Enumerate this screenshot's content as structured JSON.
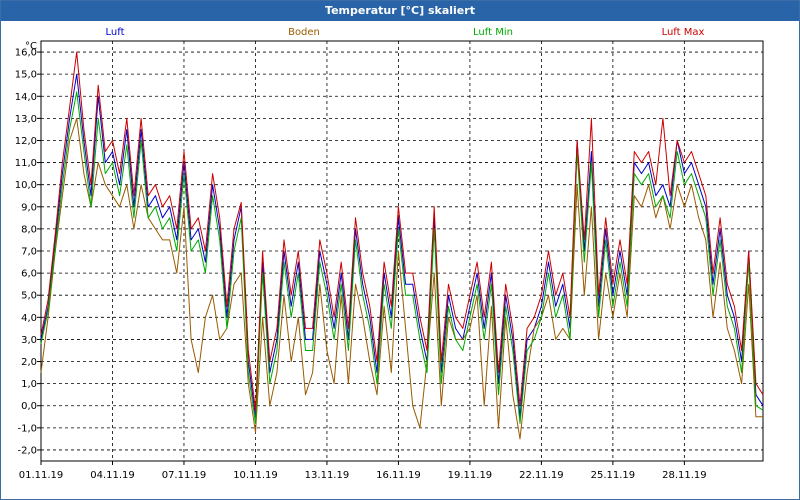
{
  "window": {
    "title": "Temperatur [°C] skaliert"
  },
  "chart_data": {
    "type": "line",
    "ylabel": "°C",
    "ylim": [
      -2.5,
      16.5
    ],
    "grid": true,
    "legend_placement": "top",
    "yticks": [
      -2,
      -1,
      0,
      1,
      2,
      3,
      4,
      5,
      6,
      7,
      8,
      9,
      10,
      11,
      12,
      13,
      14,
      15,
      16
    ],
    "ytick_labels": [
      "-2,0",
      "-1,0",
      "0,0",
      "1,0",
      "2,0",
      "3,0",
      "4,0",
      "5,0",
      "6,0",
      "7,0",
      "8,0",
      "9,0",
      "10,0",
      "11,0",
      "12,0",
      "13,0",
      "14,0",
      "15,0",
      "16,0"
    ],
    "xticks": [
      1,
      4,
      7,
      10,
      13,
      16,
      19,
      22,
      25,
      28
    ],
    "xtick_labels": [
      "01.11.19",
      "04.11.19",
      "07.11.19",
      "10.11.19",
      "13.11.19",
      "16.11.19",
      "19.11.19",
      "22.11.19",
      "25.11.19",
      "28.11.19"
    ],
    "xlim": [
      1,
      31.3
    ],
    "x": [
      1.0,
      1.3,
      1.6,
      1.9,
      2.2,
      2.5,
      2.8,
      3.1,
      3.4,
      3.7,
      4.0,
      4.3,
      4.6,
      4.9,
      5.2,
      5.5,
      5.8,
      6.1,
      6.4,
      6.7,
      7.0,
      7.3,
      7.6,
      7.9,
      8.2,
      8.5,
      8.8,
      9.1,
      9.4,
      9.7,
      10.0,
      10.3,
      10.6,
      10.9,
      11.2,
      11.5,
      11.8,
      12.1,
      12.4,
      12.7,
      13.0,
      13.3,
      13.6,
      13.9,
      14.2,
      14.5,
      14.8,
      15.1,
      15.4,
      15.7,
      16.0,
      16.3,
      16.6,
      16.9,
      17.2,
      17.5,
      17.8,
      18.1,
      18.4,
      18.7,
      19.0,
      19.3,
      19.6,
      19.9,
      20.2,
      20.5,
      20.8,
      21.1,
      21.4,
      21.7,
      22.0,
      22.3,
      22.6,
      22.9,
      23.2,
      23.5,
      23.8,
      24.1,
      24.4,
      24.7,
      25.0,
      25.3,
      25.6,
      25.9,
      26.2,
      26.5,
      26.8,
      27.1,
      27.4,
      27.7,
      28.0,
      28.3,
      28.6,
      28.9,
      29.2,
      29.5,
      29.8,
      30.1,
      30.4,
      30.7,
      31.0,
      31.3
    ],
    "series": [
      {
        "name": "Luft",
        "color": "#0000cc",
        "values": [
          3.0,
          4.5,
          7.5,
          10.5,
          13.0,
          15.0,
          12.0,
          9.5,
          14.0,
          11.0,
          11.5,
          10.0,
          12.5,
          9.0,
          12.5,
          9.0,
          9.5,
          8.5,
          9.0,
          7.5,
          11.0,
          7.5,
          8.0,
          6.5,
          10.0,
          8.0,
          4.0,
          7.5,
          9.0,
          2.0,
          -0.5,
          6.5,
          1.5,
          3.0,
          7.0,
          4.5,
          6.5,
          3.0,
          3.0,
          7.0,
          5.5,
          3.5,
          6.0,
          3.0,
          8.0,
          5.5,
          4.0,
          1.5,
          6.0,
          4.0,
          8.5,
          5.5,
          5.5,
          3.5,
          2.0,
          8.5,
          1.5,
          5.0,
          3.5,
          3.0,
          4.5,
          6.0,
          3.5,
          6.0,
          1.0,
          5.0,
          3.0,
          -0.5,
          3.0,
          3.5,
          4.5,
          6.5,
          4.5,
          5.5,
          3.5,
          12.0,
          7.0,
          11.5,
          4.5,
          8.0,
          5.0,
          7.0,
          5.0,
          11.0,
          10.5,
          11.0,
          9.5,
          10.0,
          9.0,
          12.0,
          10.5,
          11.0,
          10.0,
          9.0,
          5.5,
          8.0,
          5.0,
          4.0,
          2.0,
          7.0,
          0.5,
          0.0
        ]
      },
      {
        "name": "Boden",
        "color": "#9a5a00",
        "values": [
          1.5,
          4.0,
          7.0,
          9.5,
          12.0,
          13.0,
          10.5,
          9.0,
          11.0,
          10.0,
          9.5,
          9.0,
          10.0,
          8.0,
          10.0,
          8.5,
          8.0,
          7.5,
          7.5,
          6.0,
          9.0,
          3.0,
          1.5,
          4.0,
          5.0,
          3.0,
          3.5,
          5.5,
          6.0,
          1.0,
          -1.2,
          4.0,
          0.0,
          1.5,
          5.0,
          2.0,
          4.0,
          0.5,
          1.5,
          5.5,
          2.5,
          1.0,
          5.0,
          1.0,
          5.5,
          4.0,
          2.0,
          0.5,
          4.5,
          1.5,
          7.0,
          3.5,
          0.0,
          -1.0,
          2.0,
          6.0,
          0.0,
          4.0,
          3.0,
          3.0,
          3.5,
          5.0,
          0.0,
          4.5,
          -1.0,
          4.0,
          0.5,
          -1.5,
          1.5,
          3.5,
          4.0,
          5.0,
          3.0,
          3.5,
          3.0,
          10.0,
          5.0,
          9.0,
          3.0,
          6.0,
          4.0,
          6.0,
          4.0,
          9.5,
          9.0,
          10.0,
          8.5,
          9.5,
          8.0,
          10.0,
          9.0,
          10.0,
          8.5,
          7.5,
          4.0,
          6.5,
          3.5,
          2.5,
          1.0,
          5.5,
          -0.5,
          -0.5
        ]
      },
      {
        "name": "Luft Min",
        "color": "#00aa00",
        "values": [
          2.8,
          4.3,
          7.2,
          10.0,
          12.5,
          14.2,
          11.5,
          9.0,
          13.0,
          10.5,
          11.0,
          9.5,
          11.8,
          8.5,
          12.0,
          8.5,
          9.0,
          8.0,
          8.5,
          7.0,
          10.5,
          7.0,
          7.5,
          6.0,
          9.5,
          7.5,
          3.5,
          7.0,
          8.5,
          1.5,
          -0.8,
          6.0,
          1.0,
          2.5,
          6.5,
          4.0,
          6.0,
          2.5,
          2.5,
          6.5,
          5.0,
          3.0,
          5.5,
          2.5,
          7.5,
          5.0,
          3.5,
          1.0,
          5.5,
          3.5,
          8.0,
          5.0,
          5.0,
          3.0,
          1.5,
          8.0,
          1.0,
          4.5,
          3.0,
          2.5,
          4.0,
          5.5,
          3.0,
          5.5,
          0.5,
          4.5,
          2.5,
          -0.8,
          2.5,
          3.0,
          4.0,
          6.0,
          4.0,
          5.0,
          3.0,
          11.5,
          6.5,
          11.0,
          4.0,
          7.5,
          4.5,
          6.5,
          4.5,
          10.5,
          10.0,
          10.5,
          9.0,
          9.5,
          8.5,
          11.5,
          10.0,
          10.5,
          9.5,
          8.5,
          5.0,
          7.5,
          4.5,
          3.5,
          1.5,
          6.5,
          0.0,
          -0.2
        ]
      },
      {
        "name": "Luft Max",
        "color": "#cc0000",
        "values": [
          3.2,
          4.8,
          7.8,
          11.0,
          13.5,
          16.0,
          12.5,
          10.0,
          14.5,
          11.5,
          12.0,
          10.5,
          13.0,
          9.5,
          13.0,
          9.5,
          10.0,
          9.0,
          9.5,
          8.0,
          11.5,
          8.0,
          8.5,
          7.0,
          10.5,
          8.5,
          4.5,
          8.0,
          9.2,
          2.5,
          -0.2,
          7.0,
          2.0,
          3.5,
          7.5,
          5.0,
          7.0,
          3.5,
          3.5,
          7.5,
          6.0,
          4.0,
          6.5,
          3.5,
          8.5,
          6.0,
          4.5,
          2.0,
          6.5,
          4.5,
          9.0,
          6.0,
          6.0,
          4.0,
          2.5,
          9.0,
          2.0,
          5.5,
          4.0,
          3.5,
          5.0,
          6.5,
          4.0,
          6.5,
          1.5,
          5.5,
          3.5,
          0.0,
          3.5,
          4.0,
          5.0,
          7.0,
          5.0,
          6.0,
          4.0,
          12.0,
          7.5,
          13.0,
          5.0,
          8.5,
          5.5,
          7.5,
          5.5,
          11.5,
          11.0,
          11.5,
          10.0,
          13.0,
          9.5,
          12.0,
          11.0,
          11.5,
          10.5,
          9.5,
          6.0,
          8.5,
          5.5,
          4.5,
          2.5,
          7.0,
          1.0,
          0.5
        ]
      }
    ]
  }
}
